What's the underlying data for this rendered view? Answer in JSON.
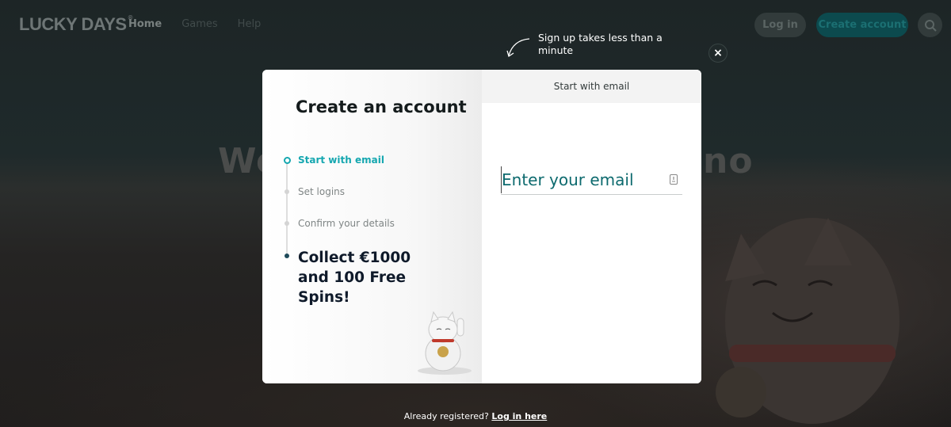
{
  "nav": {
    "logo": "LUCKY DAYS",
    "logo_mark": "®",
    "links": [
      "Home",
      "Games",
      "Help"
    ],
    "login_label": "Log in",
    "create_label": "Create account",
    "search_icon": "search-icon"
  },
  "background": {
    "headline_left": "We",
    "headline_right": "no"
  },
  "hint": {
    "text": "Sign up takes less than a minute",
    "arrow_icon": "curved-arrow-icon"
  },
  "close_icon": "×",
  "modal": {
    "title": "Create an account",
    "steps": [
      "Start with email",
      "Set logins",
      "Confirm your details"
    ],
    "active_step": 0,
    "reward": "Collect €1000 and 100 Free Spins!",
    "tab_label": "Start with email",
    "email_placeholder": "Enter your email",
    "email_value": "",
    "field_icon": "autofill-icon"
  },
  "footer": {
    "text": "Already registered?",
    "link": "Log in here"
  },
  "colors": {
    "accent": "#15a7b0",
    "brand_dark": "#0c4a4e",
    "input_text": "#0d6a6e"
  }
}
